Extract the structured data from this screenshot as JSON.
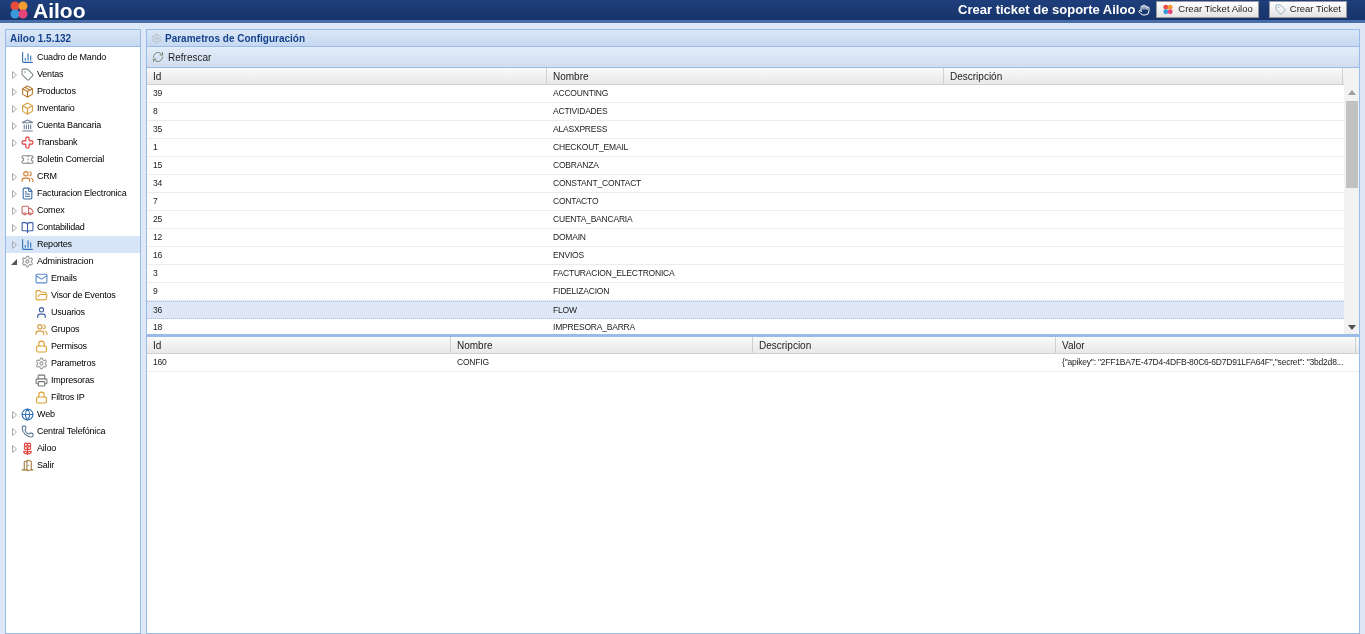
{
  "header": {
    "logo": "Ailoo",
    "support_text": "Crear ticket de soporte Ailoo",
    "buttons": [
      "Crear Ticket Ailoo",
      "Crear Ticket"
    ]
  },
  "sidebar": {
    "title": "Ailoo 1.5.132",
    "items": [
      {
        "label": "Cuadro de Mando",
        "selected": false
      },
      {
        "label": "Ventas",
        "expanded": false,
        "selected": false
      },
      {
        "label": "Productos",
        "expanded": false,
        "selected": false
      },
      {
        "label": "Inventario",
        "expanded": false,
        "selected": false
      },
      {
        "label": "Cuenta Bancaria",
        "expanded": false,
        "selected": false
      },
      {
        "label": "Transbank",
        "expanded": false,
        "selected": false
      },
      {
        "label": "Boletin Comercial",
        "selected": false
      },
      {
        "label": "CRM",
        "expanded": false,
        "selected": false
      },
      {
        "label": "Facturacion Electronica",
        "expanded": false,
        "selected": false
      },
      {
        "label": "Comex",
        "expanded": false,
        "selected": false
      },
      {
        "label": "Contabilidad",
        "expanded": false,
        "selected": false
      },
      {
        "label": "Reportes",
        "expanded": false,
        "selected": true
      },
      {
        "label": "Administracion",
        "expanded": true,
        "selected": false,
        "children": [
          {
            "label": "Emails",
            "selected": false
          },
          {
            "label": "Visor de Eventos",
            "selected": false
          },
          {
            "label": "Usuarios",
            "selected": false
          },
          {
            "label": "Grupos",
            "selected": false
          },
          {
            "label": "Permisos",
            "selected": false
          },
          {
            "label": "Parametros",
            "selected": false
          },
          {
            "label": "Impresoras",
            "selected": false
          },
          {
            "label": "Filtros IP",
            "selected": false
          }
        ]
      },
      {
        "label": "Web",
        "expanded": false,
        "selected": false
      },
      {
        "label": "Central Telefónica",
        "expanded": false,
        "selected": false
      },
      {
        "label": "Ailoo",
        "expanded": false,
        "selected": false
      },
      {
        "label": "Salir",
        "selected": false
      }
    ]
  },
  "panel": {
    "title": "Parametros de Configuración",
    "toolbar": [
      "Refrescar"
    ],
    "upper_table": {
      "columns": [
        "Id",
        "Nombre",
        "Descripción"
      ],
      "rows": [
        {
          "cells": [
            "39",
            "ACCOUNTING",
            ""
          ],
          "selected": false
        },
        {
          "cells": [
            "8",
            "ACTIVIDADES",
            ""
          ],
          "selected": false
        },
        {
          "cells": [
            "35",
            "ALASXPRESS",
            ""
          ],
          "selected": false
        },
        {
          "cells": [
            "1",
            "CHECKOUT_EMAIL",
            ""
          ],
          "selected": false
        },
        {
          "cells": [
            "15",
            "COBRANZA",
            ""
          ],
          "selected": false
        },
        {
          "cells": [
            "34",
            "CONSTANT_CONTACT",
            ""
          ],
          "selected": false
        },
        {
          "cells": [
            "7",
            "CONTACTO",
            ""
          ],
          "selected": false
        },
        {
          "cells": [
            "25",
            "CUENTA_BANCARIA",
            ""
          ],
          "selected": false
        },
        {
          "cells": [
            "12",
            "DOMAIN",
            ""
          ],
          "selected": false
        },
        {
          "cells": [
            "16",
            "ENVIOS",
            ""
          ],
          "selected": false
        },
        {
          "cells": [
            "3",
            "FACTURACION_ELECTRONICA",
            ""
          ],
          "selected": false
        },
        {
          "cells": [
            "9",
            "FIDELIZACION",
            ""
          ],
          "selected": false
        },
        {
          "cells": [
            "36",
            "FLOW",
            ""
          ],
          "selected": true
        },
        {
          "cells": [
            "18",
            "IMPRESORA_BARRA",
            ""
          ],
          "selected": false
        }
      ]
    },
    "lower_table": {
      "columns": [
        "Id",
        "Nombre",
        "Descripcion",
        "Valor"
      ],
      "rows": [
        {
          "cells": [
            "160",
            "CONFIG",
            "",
            "{\"apikey\": \"2FF1BA7E-47D4-4DFB-80C6-6D7D91LFA64F\",\"secret\": \"3bd2d8..."
          ]
        }
      ]
    }
  }
}
